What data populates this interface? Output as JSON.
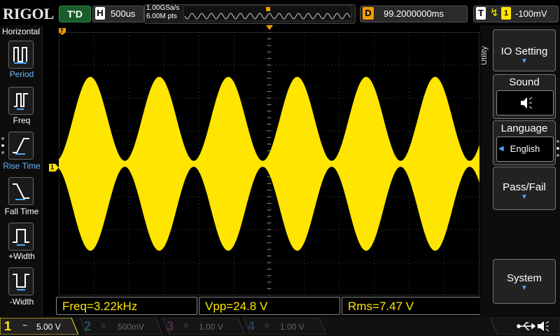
{
  "brand": {
    "name": "RIGOL"
  },
  "run_status": "T'D",
  "horizontal": {
    "letter": "H",
    "timebase": "500us"
  },
  "sampling": {
    "rate": "1.00GSa/s",
    "points": "6.00M pts"
  },
  "delay": {
    "letter": "D",
    "value": "99.2000000ms"
  },
  "trigger": {
    "letter": "T",
    "channel": "1",
    "level": "-100mV",
    "edge_icon": "rising-edge-icon"
  },
  "left_menu": {
    "title": "Horizontal",
    "items": [
      {
        "label": "Period",
        "icon": "period-icon"
      },
      {
        "label": "Freq",
        "icon": "freq-icon"
      },
      {
        "label": "Rise Time",
        "icon": "rise-time-icon"
      },
      {
        "label": "Fall Time",
        "icon": "fall-time-icon"
      },
      {
        "label": "+Width",
        "icon": "pos-width-icon"
      },
      {
        "label": "-Width",
        "icon": "neg-width-icon"
      }
    ]
  },
  "markers": {
    "ch1_offset": "1",
    "trigger_level": "T",
    "trigger_pos": "T"
  },
  "measurements": [
    {
      "label": "Freq=3.22kHz"
    },
    {
      "label": "Vpp=24.8 V"
    },
    {
      "label": "Rms=7.47 V"
    }
  ],
  "right_menu": {
    "side_label": "Utility",
    "io_setting": "IO Setting",
    "sound": "Sound",
    "language": "Language",
    "language_value": "English",
    "pass_fail": "Pass/Fail",
    "system": "System"
  },
  "channels": [
    {
      "num": "1",
      "coupling": "~",
      "scale": "5.00 V",
      "color": "#ffe600",
      "active": true
    },
    {
      "num": "2",
      "coupling": "≡",
      "scale": "500mV",
      "color": "#1fb4e6",
      "active": false
    },
    {
      "num": "3",
      "coupling": "≡",
      "scale": "1.00 V",
      "color": "#e43cb4",
      "active": false
    },
    {
      "num": "4",
      "coupling": "≡",
      "scale": "1.00 V",
      "color": "#2f6fe4",
      "active": false
    }
  ],
  "colors": {
    "ch1": "#ffe600",
    "trigger": "#f59b00",
    "accent": "#4aa8ff"
  },
  "status_icons": [
    "usb-icon",
    "speaker-icon"
  ]
}
